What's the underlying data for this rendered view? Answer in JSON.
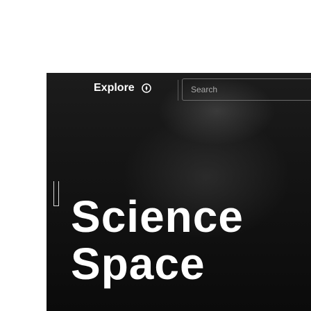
{
  "nav": {
    "explore_label": "Explore",
    "compass_icon": "compass-icon",
    "search_placeholder": "Search"
  },
  "hero": {
    "headline_line1": "Science",
    "headline_line2": "Space"
  },
  "colors": {
    "hero_background": "#151515",
    "text": "#ffffff",
    "divider": "#5a5a5a"
  }
}
